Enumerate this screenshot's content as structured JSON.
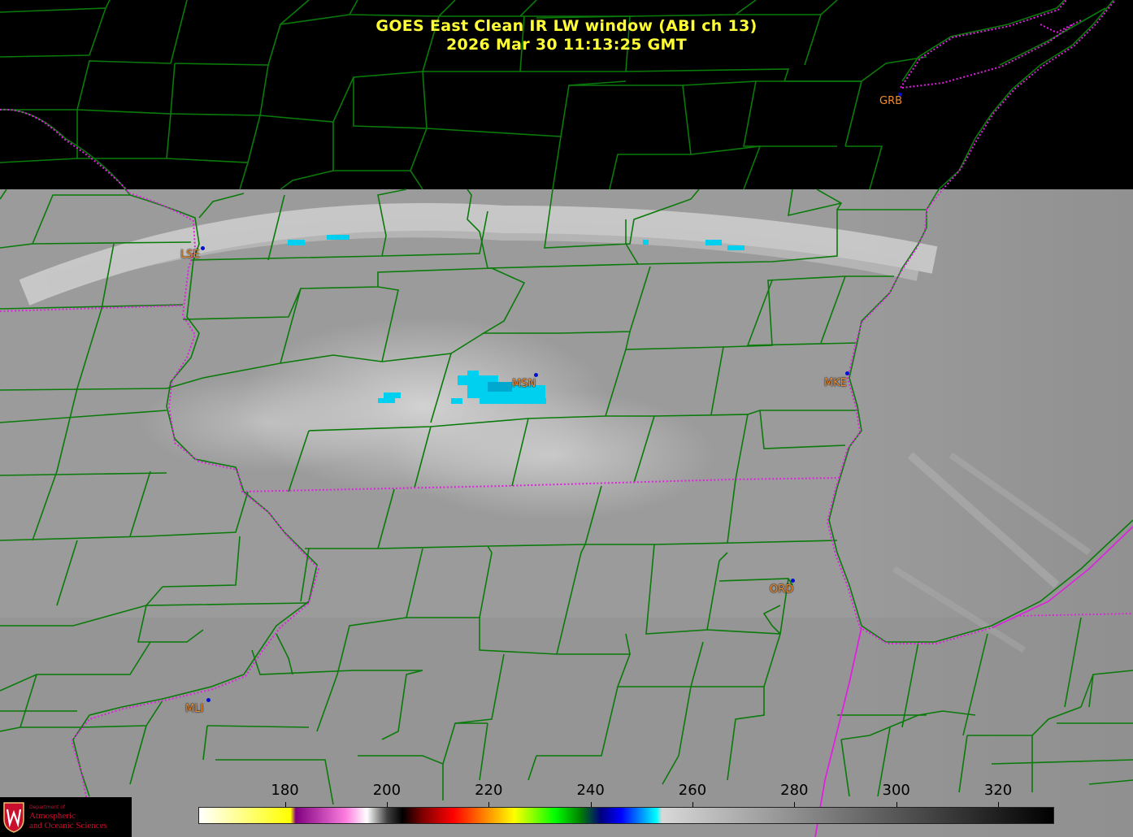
{
  "header": {
    "title_line1": "GOES East Clean IR LW window (ABI ch 13)",
    "title_line2": "2026 Mar 30  11:13:25 GMT"
  },
  "stations": [
    {
      "id": "GRB",
      "label": "GRB"
    },
    {
      "id": "LSE",
      "label": "LSE"
    },
    {
      "id": "MSN",
      "label": "MSN"
    },
    {
      "id": "MKE",
      "label": "MKE"
    },
    {
      "id": "ORD",
      "label": "ORD"
    },
    {
      "id": "MLI",
      "label": "MLI"
    }
  ],
  "colorbar": {
    "ticks": [
      "180",
      "200",
      "220",
      "240",
      "260",
      "280",
      "300",
      "320"
    ],
    "range": [
      163,
      331
    ],
    "tick_values": [
      180,
      200,
      220,
      240,
      260,
      280,
      300,
      320
    ]
  },
  "colors": {
    "title": "#ffff33",
    "county_lines": "#0a7a0a",
    "state_lines": "#e020e0",
    "station_label": "#f08a2a",
    "station_dot": "#0010d0",
    "cold_cloud": "#00d0f0"
  },
  "logo": {
    "small": "Department of",
    "line1": "Atmospheric",
    "line2": "and Oceanic Sciences"
  }
}
